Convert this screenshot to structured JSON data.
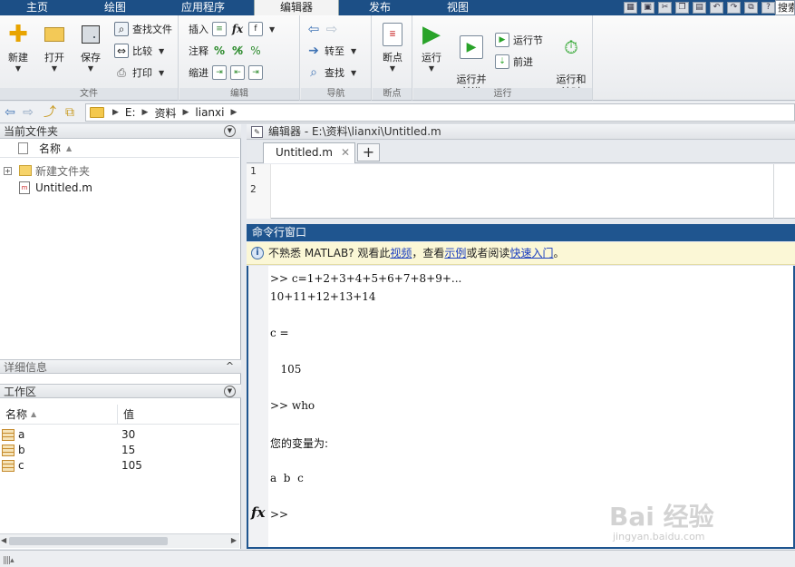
{
  "ribbon_tabs": [
    {
      "label": "主页"
    },
    {
      "label": "绘图"
    },
    {
      "label": "应用程序"
    },
    {
      "label": "编辑器",
      "active": true
    },
    {
      "label": "发布"
    },
    {
      "label": "视图"
    }
  ],
  "search_box": {
    "value": "搜索"
  },
  "ribbon": {
    "file": {
      "new": "新建",
      "open": "打开",
      "save": "保存",
      "find_files": "查找文件",
      "compare": "比较",
      "print": "打印",
      "group_label": "文件"
    },
    "edit": {
      "insert": "插入",
      "comment": "注释",
      "indent": "缩进",
      "group_label": "编辑"
    },
    "navigate": {
      "goto": "转至",
      "find": "查找",
      "group_label": "导航"
    },
    "breakpoints": {
      "breakpoints": "断点",
      "group_label": "断点"
    },
    "run": {
      "run": "运行",
      "run_advance": "运行并\n前进",
      "run_section": "运行节",
      "advance": "前进",
      "run_and_time": "运行和\n计时",
      "group_label": "运行"
    }
  },
  "address_bar": {
    "segments": [
      "E:",
      "资料",
      "lianxi"
    ]
  },
  "current_folder": {
    "title": "当前文件夹",
    "column_name": "名称",
    "items": [
      {
        "name": "新建文件夹",
        "type": "folder"
      },
      {
        "name": "Untitled.m",
        "type": "m-file"
      }
    ]
  },
  "details": {
    "title": "详细信息"
  },
  "workspace": {
    "title": "工作区",
    "col_name": "名称",
    "col_value": "值",
    "rows": [
      {
        "name": "a",
        "value": "30"
      },
      {
        "name": "b",
        "value": "15"
      },
      {
        "name": "c",
        "value": "105"
      }
    ]
  },
  "editor": {
    "title": "编辑器 - E:\\资料\\lianxi\\Untitled.m",
    "tab_label": "Untitled.m",
    "line_numbers": [
      "1",
      "2"
    ]
  },
  "command_window": {
    "title": "命令行窗口",
    "info_prefix": "不熟悉 MATLAB? 观看此",
    "info_link_video": "视频",
    "info_mid1": "，查看",
    "info_link_examples": "示例",
    "info_mid2": "或者阅读",
    "info_link_getting_started": "快速入门",
    "info_suffix": "。",
    "lines": [
      ">> c=1+2+3+4+5+6+7+8+9+...",
      "10+11+12+13+14",
      "c =",
      "   105",
      ">> who",
      "您的变量为:",
      "a  b  c",
      ">>"
    ]
  },
  "watermark": {
    "main": "Bai 经验",
    "sub": "jingyan.baidu.com"
  }
}
